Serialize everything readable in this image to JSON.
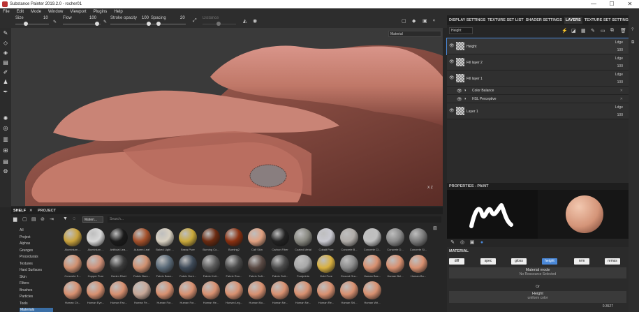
{
  "window": {
    "title": "Substance Painter 2019.2.0 - rocher01",
    "min": "—",
    "max": "☐",
    "close": "✕"
  },
  "menu": [
    "File",
    "Edit",
    "Mode",
    "Window",
    "Viewport",
    "Plugins",
    "Help"
  ],
  "toolbar": {
    "size_label": "Size",
    "size_value": "10",
    "flow_label": "Flow",
    "flow_value": "100",
    "stroke_label": "Stroke opacity",
    "stroke_value": "100",
    "spacing_label": "Spacing",
    "spacing_value": "20",
    "distance_label": "Distance"
  },
  "viewport": {
    "mode_select": "Material",
    "axis_label": "X  Z"
  },
  "right_tabs": {
    "display": "DISPLAY SETTINGS",
    "texture_list": "TEXTURE SET LIST",
    "shader": "SHADER SETTINGS",
    "layers": "LAYERS",
    "texture_settings": "TEXTURE SET SETTINGS"
  },
  "layers": {
    "channel": "Height",
    "items": [
      {
        "name": "Height",
        "blend": "Ldge",
        "opacity": "100"
      },
      {
        "name": "Fill layer 2",
        "blend": "Ldge",
        "opacity": "100"
      },
      {
        "name": "Fill layer 1",
        "blend": "Ldge",
        "opacity": "100"
      },
      {
        "name": "Color Balance"
      },
      {
        "name": "HSL Perceptive"
      },
      {
        "name": "Layer 1",
        "blend": "Ldge",
        "opacity": "100"
      }
    ]
  },
  "properties": {
    "title": "PROPERTIES - PAINT",
    "section": "MATERIAL",
    "channels": [
      "diff",
      "spec",
      "gloss",
      "height",
      "nrm",
      "nrmss"
    ],
    "material_mode": "Material mode",
    "no_resource": "No Ressource Selected",
    "or": "Or",
    "height_label": "Height",
    "uniform": "uniform color",
    "value": "0.3527"
  },
  "shelf": {
    "tab_shelf": "SHELF",
    "tab_project": "PROJECT",
    "filter": "Materi...",
    "search_placeholder": "Search...",
    "categories": [
      "All",
      "Project",
      "Alphas",
      "Grunges",
      "Procedurals",
      "Textures",
      "Hard Surfaces",
      "Skin",
      "Filters",
      "Brushes",
      "Particles",
      "Tools",
      "Materials"
    ],
    "materials": [
      {
        "name": "Aluminium ...",
        "color": "#c9a23c"
      },
      {
        "name": "Aluminium ...",
        "color": "#d8d8d8"
      },
      {
        "name": "Artificial Lea...",
        "color": "#1a1a1a"
      },
      {
        "name": "Autumn Leaf",
        "color": "#a4502a"
      },
      {
        "name": "Baked Light ...",
        "color": "#d8d0c0"
      },
      {
        "name": "Brass Pure",
        "color": "#c9a83a"
      },
      {
        "name": "Burning Co...",
        "color": "#6a2a10"
      },
      {
        "name": "Burning2",
        "color": "#8a3010"
      },
      {
        "name": "Calf Skin",
        "color": "#e0a080"
      },
      {
        "name": "Carbon Fiber",
        "color": "#222222"
      },
      {
        "name": "Coated Metal",
        "color": "#888880"
      },
      {
        "name": "Cobalt Pure",
        "color": "#c8c8d0"
      },
      {
        "name": "Concrete B...",
        "color": "#b0aca8"
      },
      {
        "name": "Concrete Cl...",
        "color": "#c0c0c0"
      },
      {
        "name": "Concrete D...",
        "color": "#8a8a8a"
      },
      {
        "name": "Concrete Si...",
        "color": "#7a7a7a"
      },
      {
        "name": "Concrete S...",
        "color": "#d09070"
      },
      {
        "name": "Copper Pure",
        "color": "#d09078"
      },
      {
        "name": "Denim Rivet",
        "color": "#3a3a3a"
      },
      {
        "name": "Fabric Bam...",
        "color": "#d09070"
      },
      {
        "name": "Fabric Base...",
        "color": "#5a6a78"
      },
      {
        "name": "Fabric Deni...",
        "color": "#3e4a58"
      },
      {
        "name": "Fabric Knit...",
        "color": "#5a5a5a"
      },
      {
        "name": "Fabric Rou...",
        "color": "#4a4a4a"
      },
      {
        "name": "Fabric Soft...",
        "color": "#5a4a44"
      },
      {
        "name": "Fabric Suit...",
        "color": "#4a4a4a"
      },
      {
        "name": "Footprints",
        "color": "#a8a8a8"
      },
      {
        "name": "Gold Pure",
        "color": "#d8b040"
      },
      {
        "name": "Ground Gra...",
        "color": "#8a8a8a"
      },
      {
        "name": "Human Bac...",
        "color": "#d89070"
      },
      {
        "name": "Human Bel...",
        "color": "#d89070"
      },
      {
        "name": "Human Bu...",
        "color": "#d89070"
      },
      {
        "name": "Human Ch...",
        "color": "#d89070"
      },
      {
        "name": "Human Eye...",
        "color": "#d89070"
      },
      {
        "name": "Human Fac...",
        "color": "#d89070"
      },
      {
        "name": "Human Fe...",
        "color": "#c8a898"
      },
      {
        "name": "Human For...",
        "color": "#d89070"
      },
      {
        "name": "Human For...",
        "color": "#d89070"
      },
      {
        "name": "Human He...",
        "color": "#d89070"
      },
      {
        "name": "Human Leg...",
        "color": "#d89070"
      },
      {
        "name": "Human Mo...",
        "color": "#d89070"
      },
      {
        "name": "Human Ne...",
        "color": "#d89070"
      },
      {
        "name": "Human Ne...",
        "color": "#d89070"
      },
      {
        "name": "Human Re...",
        "color": "#d89070"
      },
      {
        "name": "Human Shi...",
        "color": "#d89070"
      },
      {
        "name": "Human Wri...",
        "color": "#d89070"
      }
    ]
  },
  "colors": {
    "accent": "#4a88d8",
    "selection": "#3a6ea5"
  }
}
